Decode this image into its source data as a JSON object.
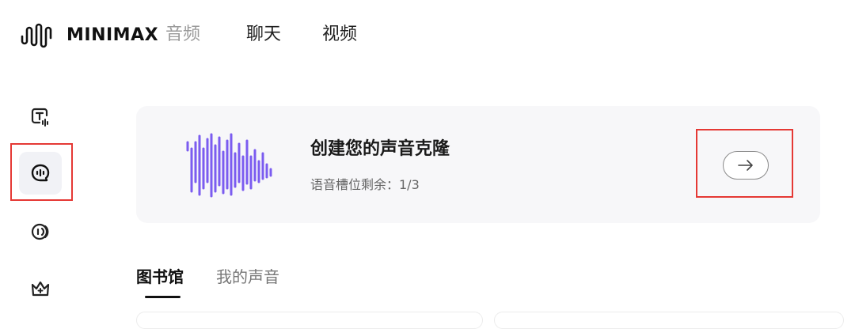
{
  "header": {
    "logo_text": "MINIMAX",
    "nav": [
      {
        "label": "音频",
        "active": true
      },
      {
        "label": "聊天",
        "active": false
      },
      {
        "label": "视频",
        "active": false
      }
    ]
  },
  "sidebar": {
    "items": [
      {
        "icon": "text-to-speech-icon",
        "active": false
      },
      {
        "icon": "voice-clone-icon",
        "active": true
      },
      {
        "icon": "audio-broadcast-icon",
        "active": false
      },
      {
        "icon": "crown-icon",
        "active": false
      }
    ]
  },
  "clone_card": {
    "title": "创建您的声音克隆",
    "slots": "语音槽位剩余：1/3",
    "arrow_icon": "arrow-right-icon"
  },
  "tabs": [
    {
      "label": "图书馆",
      "active": true
    },
    {
      "label": "我的声音",
      "active": false
    }
  ],
  "colors": {
    "accent": "#7b5cf0",
    "highlight": "#e53935"
  }
}
